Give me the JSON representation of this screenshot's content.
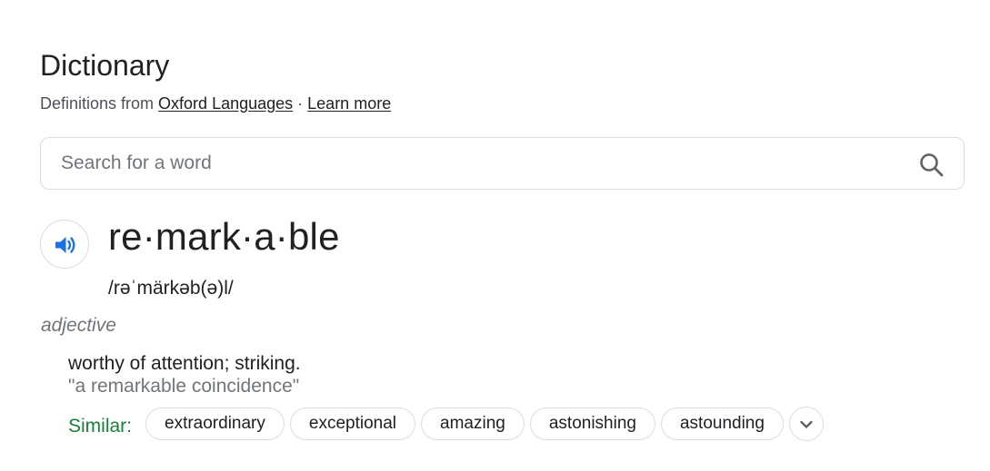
{
  "header": {
    "title": "Dictionary",
    "source_prefix": "Definitions from ",
    "source_link": "Oxford Languages",
    "separator": " · ",
    "learn_more": "Learn more"
  },
  "search": {
    "placeholder": "Search for a word",
    "value": "",
    "icon": "search-icon"
  },
  "entry": {
    "speaker_icon": "speaker-icon",
    "headword": "re·mark·a·ble",
    "phonetic": "/rəˈmärkəb(ə)l/",
    "part_of_speech": "adjective",
    "definition": "worthy of attention; striking.",
    "example": "\"a remarkable coincidence\"",
    "similar_label": "Similar:",
    "similar": [
      "extraordinary",
      "exceptional",
      "amazing",
      "astonishing",
      "astounding"
    ],
    "more_icon": "chevron-down-icon"
  },
  "colors": {
    "accent_blue": "#1a73e8",
    "similar_green": "#188038",
    "muted_gray": "#70757a",
    "border": "#dadce0"
  }
}
